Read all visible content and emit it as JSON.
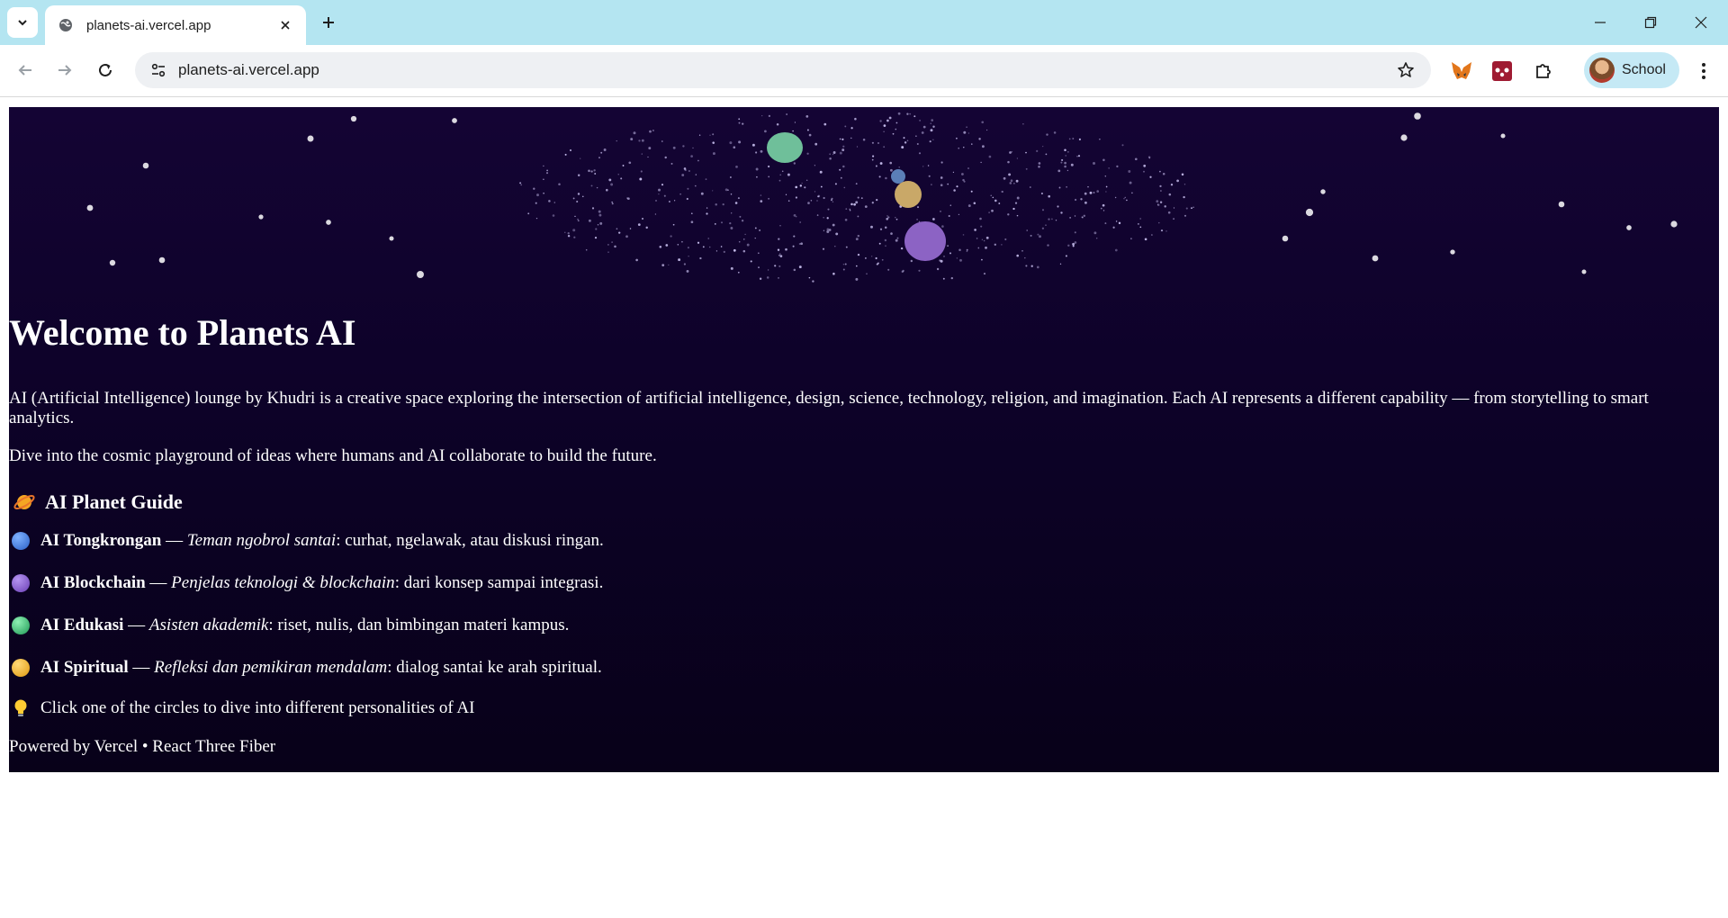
{
  "browser": {
    "tab_title": "planets-ai.vercel.app",
    "url": "planets-ai.vercel.app",
    "profile_label": "School"
  },
  "page": {
    "title": "Welcome to Planets AI",
    "intro": "AI (Artificial Intelligence) lounge by Khudri is a creative space exploring the intersection of artificial intelligence, design, science, technology, religion, and imagination. Each AI represents a different capability — from storytelling to smart analytics.",
    "intro_2": "Dive into the cosmic playground of ideas where humans and AI collaborate to build the future.",
    "guide_heading": "AI Planet Guide",
    "guide": [
      {
        "name": "AI Tongkrongan",
        "sep": " — ",
        "tagline": "Teman ngobrol santai",
        "desc": ": curhat, ngelawak, atau diskusi ringan.",
        "color": "#3f7fe0"
      },
      {
        "name": "AI Blockchain",
        "sep": " — ",
        "tagline": "Penjelas teknologi & blockchain",
        "desc": ": dari konsep sampai integrasi.",
        "color": "#8a5fd0"
      },
      {
        "name": "AI Edukasi",
        "sep": " — ",
        "tagline": "Asisten akademik",
        "desc": ": riset, nulis, dan bimbingan materi kampus.",
        "color": "#3fc07a"
      },
      {
        "name": "AI Spiritual",
        "sep": " — ",
        "tagline": "Refleksi dan pemikiran mendalam",
        "desc": ": dialog santai ke arah spiritual.",
        "color": "#f0b030"
      }
    ],
    "hint": "Click one of the circles to dive into different personalities of AI",
    "footer": "Powered by Vercel • React Three Fiber"
  },
  "planets": [
    {
      "name": "AI Edukasi",
      "color": "#6fbf9a"
    },
    {
      "name": "AI Tongkrongan",
      "color": "#5b7fb8"
    },
    {
      "name": "AI Spiritual",
      "color": "#c9a868"
    },
    {
      "name": "AI Blockchain",
      "color": "#8c63c4"
    }
  ]
}
